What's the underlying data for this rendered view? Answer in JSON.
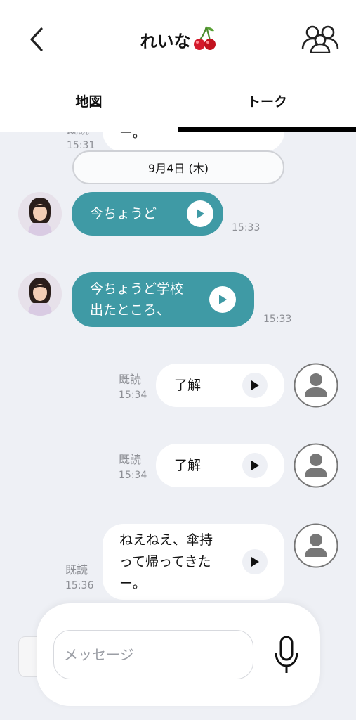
{
  "header": {
    "title": "れいな",
    "title_emoji": "🍒",
    "tabs": [
      {
        "label": "地図"
      },
      {
        "label": "トーク",
        "active": true
      }
    ]
  },
  "messages": {
    "partial_top": {
      "text": "ー。",
      "read": "既読",
      "time": "15:31"
    },
    "date_separator": "9月4日 (木)",
    "items": [
      {
        "sender": "れいな",
        "text": "今ちょうど",
        "time": "15:33"
      },
      {
        "sender": "れいな",
        "text": "今ちょうど学校\n出たところ、",
        "time": "15:33"
      },
      {
        "sender": "me",
        "text": "了解",
        "read": "既読",
        "time": "15:34"
      },
      {
        "sender": "me",
        "text": "了解",
        "read": "既読",
        "time": "15:34"
      },
      {
        "sender": "me",
        "text": "ねえねえ、傘持\nって帰ってきた\nー。",
        "read": "既読",
        "time": "15:36"
      }
    ]
  },
  "composer": {
    "placeholder": "メッセージ"
  },
  "colors": {
    "accent": "#3f9aa5",
    "background": "#eef0f5",
    "bubble": "#ffffff"
  },
  "icons": {
    "back": "chevron-left-icon",
    "group": "group-icon",
    "play": "play-icon",
    "mic": "microphone-icon",
    "default_avatar": "person-icon"
  }
}
